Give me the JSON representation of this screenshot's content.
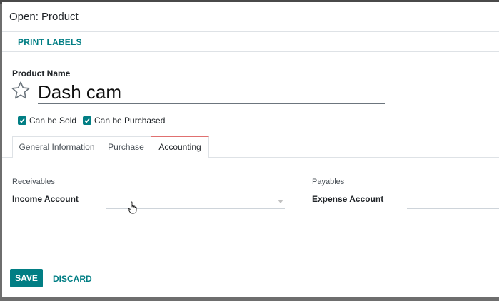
{
  "modal": {
    "title": "Open: Product"
  },
  "control_bar": {
    "print_labels": "PRINT LABELS"
  },
  "product": {
    "name_label": "Product Name",
    "name_value": "Dash cam",
    "can_be_sold": {
      "label": "Can be Sold",
      "checked": true
    },
    "can_be_purchased": {
      "label": "Can be Purchased",
      "checked": true
    }
  },
  "tabs": [
    {
      "label": "General Information",
      "active": false
    },
    {
      "label": "Purchase",
      "active": false
    },
    {
      "label": "Accounting",
      "active": true
    }
  ],
  "accounting": {
    "receivables": {
      "title": "Receivables",
      "field_label": "Income Account",
      "value": ""
    },
    "payables": {
      "title": "Payables",
      "field_label": "Expense Account",
      "value": ""
    }
  },
  "footer": {
    "save": "SAVE",
    "discard": "DISCARD"
  },
  "colors": {
    "accent": "#017e84",
    "active_tab_border": "#e07070"
  }
}
